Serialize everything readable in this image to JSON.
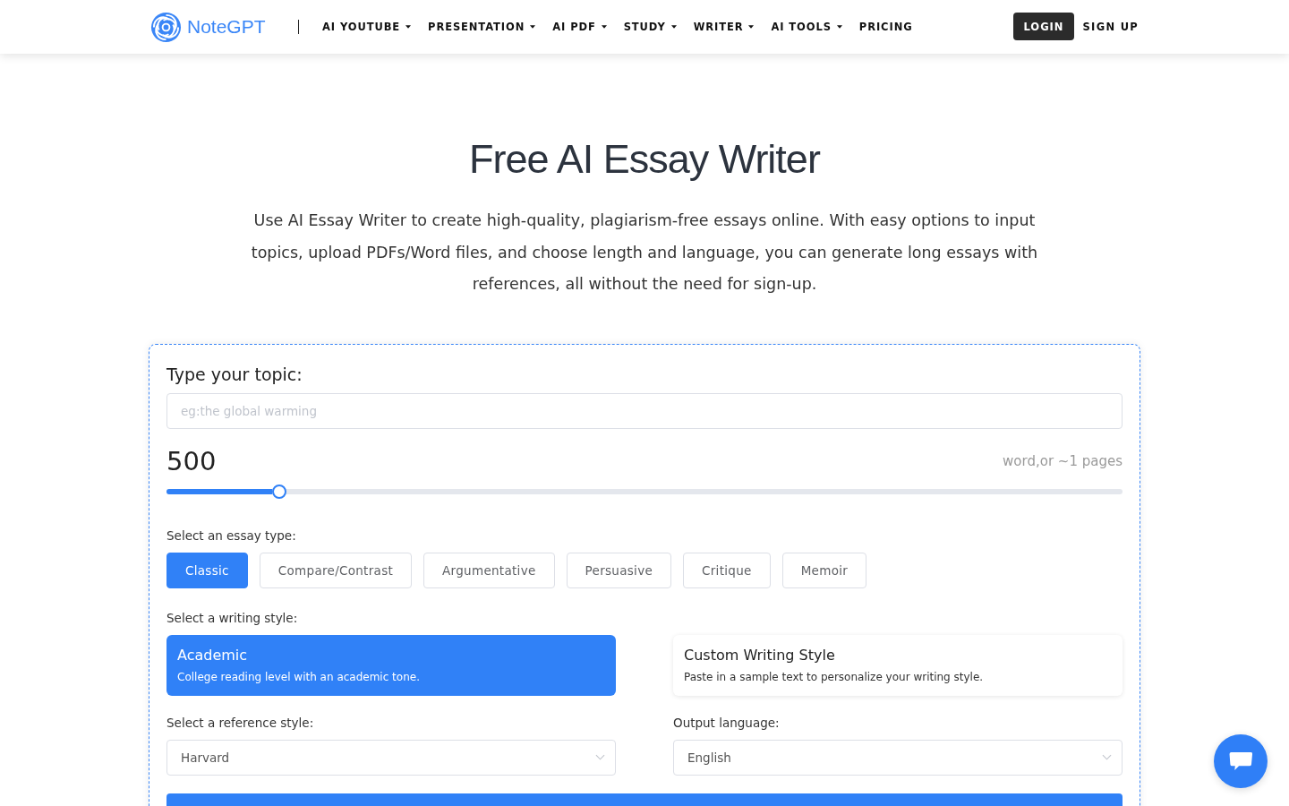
{
  "header": {
    "logo_text": "NoteGPT",
    "nav": [
      {
        "label": "AI YOUTUBE",
        "dropdown": true
      },
      {
        "label": "PRESENTATION",
        "dropdown": true
      },
      {
        "label": "AI PDF",
        "dropdown": true
      },
      {
        "label": "STUDY",
        "dropdown": true
      },
      {
        "label": "WRITER",
        "dropdown": true
      },
      {
        "label": "AI TOOLS",
        "dropdown": true
      },
      {
        "label": "PRICING",
        "dropdown": false
      }
    ],
    "login": "LOGIN",
    "signup": "SIGN UP"
  },
  "hero": {
    "title": "Free AI Essay Writer",
    "description": "Use AI Essay Writer to create high-quality, plagiarism-free essays online. With easy options to input topics, upload PDFs/Word files, and choose length and language, you can generate long essays with references, all without the need for sign-up."
  },
  "form": {
    "topic": {
      "label": "Type your topic:",
      "placeholder": "eg:the global warming"
    },
    "length": {
      "value": "500",
      "note": "word,or ~1 pages",
      "level": 0.118
    },
    "essay_type": {
      "label": "Select an essay type:",
      "options": [
        {
          "label": "Classic",
          "selected": true
        },
        {
          "label": "Compare/Contrast",
          "selected": false
        },
        {
          "label": "Argumentative",
          "selected": false
        },
        {
          "label": "Persuasive",
          "selected": false
        },
        {
          "label": "Critique",
          "selected": false
        },
        {
          "label": "Memoir",
          "selected": false
        }
      ]
    },
    "writing_style": {
      "label": "Select a writing style:",
      "options": [
        {
          "title": "Academic",
          "description": "College reading level with an academic tone.",
          "selected": true
        },
        {
          "title": "Custom Writing Style",
          "description": "Paste in a sample text to personalize your writing style.",
          "selected": false
        }
      ]
    },
    "reference_style": {
      "label": "Select a reference style:",
      "value": "Harvard"
    },
    "output_language": {
      "label": "Output language:",
      "value": "English"
    }
  }
}
